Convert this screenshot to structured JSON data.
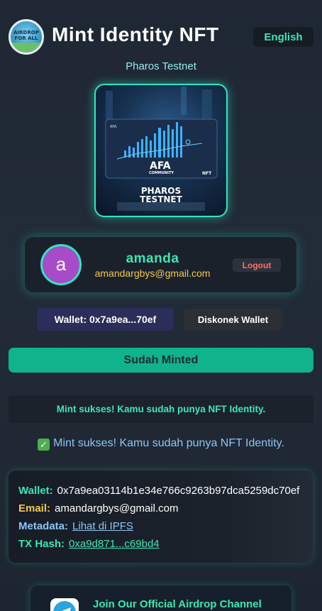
{
  "header": {
    "logo_text": "AIRDROP FOR ALL",
    "title": "Mint Identity NFT",
    "language_label": "English"
  },
  "network": "Pharos Testnet",
  "nft_card": {
    "brand": "AFA",
    "brand_sub": "COMMUNITY",
    "badge": "NFT",
    "caption_line1": "PHAROS",
    "caption_line2": "TESTNET"
  },
  "profile": {
    "avatar_initial": "a",
    "username": "amanda",
    "email": "amandargbys@gmail.com",
    "logout_label": "Logout"
  },
  "wallet": {
    "short_label": "Wallet: 0x7a9ea...70ef",
    "disconnect_label": "Diskonek Wallet"
  },
  "mint_button_label": "Sudah Minted",
  "success_banner": "Mint sukses! Kamu sudah punya NFT Identity.",
  "success_message": "Mint sukses! Kamu sudah punya NFT Identity.",
  "info": {
    "wallet_label": "Wallet:",
    "wallet_value": "0x7a9ea03114b1e34e766c9263b97dca5259dc70ef",
    "email_label": "Email:",
    "email_value": "amandargbys@gmail.com",
    "metadata_label": "Metadata:",
    "metadata_link": "Lihat di IPFS",
    "tx_label": "TX Hash:",
    "tx_link": "0xa9d871...c69bd4"
  },
  "channel": {
    "text": "Join Our Official Airdrop Channel",
    "icon": "telegram-icon"
  },
  "colors": {
    "accent": "#3ee6b3",
    "mint_button": "#10b38a",
    "email_yellow": "#f5c94a",
    "logout_red": "#ff6f6f",
    "avatar_purple": "#a84bc8"
  }
}
